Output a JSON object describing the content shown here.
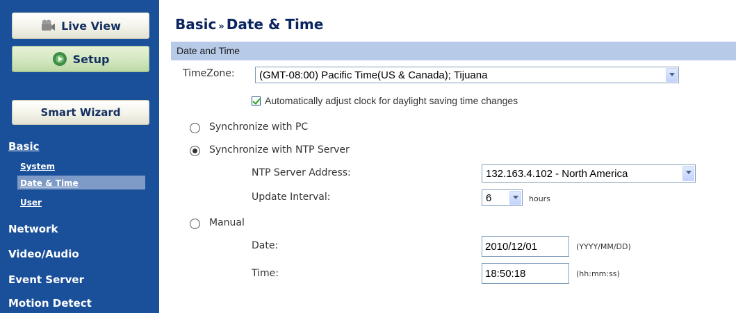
{
  "sidebar": {
    "live_view": "Live View",
    "setup": "Setup",
    "smart_wizard": "Smart Wizard",
    "basic": "Basic",
    "basic_items": [
      "System",
      "Date & Time",
      "User"
    ],
    "network": "Network",
    "video_audio": "Video/Audio",
    "event_server": "Event Server",
    "motion_detect": "Motion Detect"
  },
  "page": {
    "title_section": "Basic",
    "title_separator": "»",
    "title_page": "Date & Time",
    "section_label": "Date and Time"
  },
  "timezone": {
    "label": "TimeZone:",
    "value": "(GMT-08:00) Pacific Time(US & Canada); Tijuana",
    "dst_checked": true,
    "dst_label": "Automatically adjust clock for daylight saving time changes"
  },
  "sync": {
    "pc_label": "Synchronize with PC",
    "ntp_label": "Synchronize with NTP Server",
    "selected": "ntp",
    "ntp_address_label": "NTP Server Address:",
    "ntp_address_value": "132.163.4.102 - North America",
    "interval_label": "Update Interval:",
    "interval_value": "6",
    "interval_unit": "hours",
    "manual_label": "Manual",
    "date_label": "Date:",
    "date_value": "2010/12/01",
    "date_format": "(YYYY/MM/DD)",
    "time_label": "Time:",
    "time_value": "18:50:18",
    "time_format": "(hh:mm:ss)"
  },
  "colors": {
    "sidebar_bg": "#1a4f9a",
    "section_bar": "#b7cbe8",
    "selected_nav": "#7e9bc8",
    "title": "#0b2560"
  }
}
